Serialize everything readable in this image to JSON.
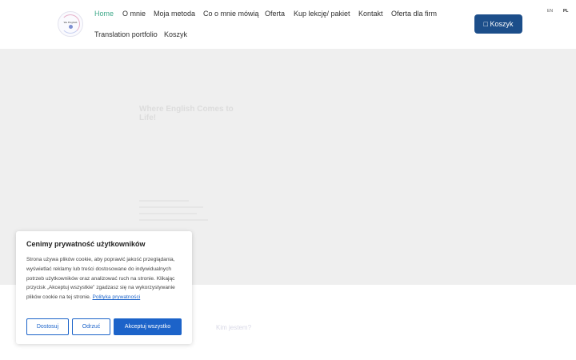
{
  "nav": {
    "items": [
      {
        "label": "Home",
        "active": true
      },
      {
        "label": "O mnie"
      },
      {
        "label": "Moja metoda"
      },
      {
        "label": "Co o mnie mówią"
      },
      {
        "label": "Oferta"
      },
      {
        "label": "Kup lekcję/ pakiet"
      },
      {
        "label": "Kontakt"
      },
      {
        "label": "Oferta dla firm"
      },
      {
        "label": "Translation portfolio"
      },
      {
        "label": "Koszyk"
      }
    ],
    "cart_button": " Koszyk",
    "languages": [
      "EN",
      "PL"
    ],
    "active_language": "PL",
    "accent_color": "#3fa98a",
    "cart_color": "#1c4e8a"
  },
  "hero": {
    "title": "Where English Comes to Life!"
  },
  "section": {
    "who_label": "Kim jestem?"
  },
  "cookie": {
    "title": "Cenimy prywatność użytkowników",
    "text": "Strona używa plików cookie, aby poprawić jakość przeglądania, wyświetlać reklamy lub treści dostosowane do indywidualnych potrzeb użytkowników oraz analizować ruch na stronie. Klikając przycisk „Akceptuj wszystkie” zgadzasz się na wykorzystywanie plików cookie na tej stronie.",
    "link": "Polityka prywatności",
    "buttons": {
      "customize": "Dostosuj",
      "reject": "Odrzuć",
      "accept": "Akceptuj wszystko"
    },
    "button_color": "#1c63c9"
  }
}
